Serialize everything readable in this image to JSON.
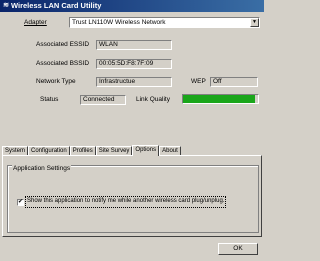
{
  "window": {
    "title": "Wireless LAN Card Utility",
    "icon": "wifi-app-icon"
  },
  "adapter": {
    "label": "Adapter",
    "value": "Trust LN110W Wireless Network"
  },
  "status": {
    "essid_label": "Associated ESSID",
    "essid_value": "WLAN",
    "bssid_label": "Associated BSSID",
    "bssid_value": "00:05:5D:F8:7F:09",
    "network_type_label": "Network Type",
    "network_type_value": "Infrastructue",
    "wep_label": "WEP",
    "wep_value": "Off",
    "status_label": "Status",
    "status_value": "Connected",
    "link_quality_label": "Link Quality",
    "link_quality_fraction": 0.96,
    "link_quality_color": "#1aa61a"
  },
  "tabs": [
    {
      "label": "System"
    },
    {
      "label": "Configuration"
    },
    {
      "label": "Profiles"
    },
    {
      "label": "Site Survey"
    },
    {
      "label": "Options",
      "active": true
    },
    {
      "label": "About"
    }
  ],
  "options": {
    "group_title": "Application Settings",
    "notify_label": "Show this application to notify me while another wireless card plug/unplug.",
    "notify_checked": true,
    "checkmark": "✔"
  },
  "footer": {
    "ok_label": "OK"
  }
}
